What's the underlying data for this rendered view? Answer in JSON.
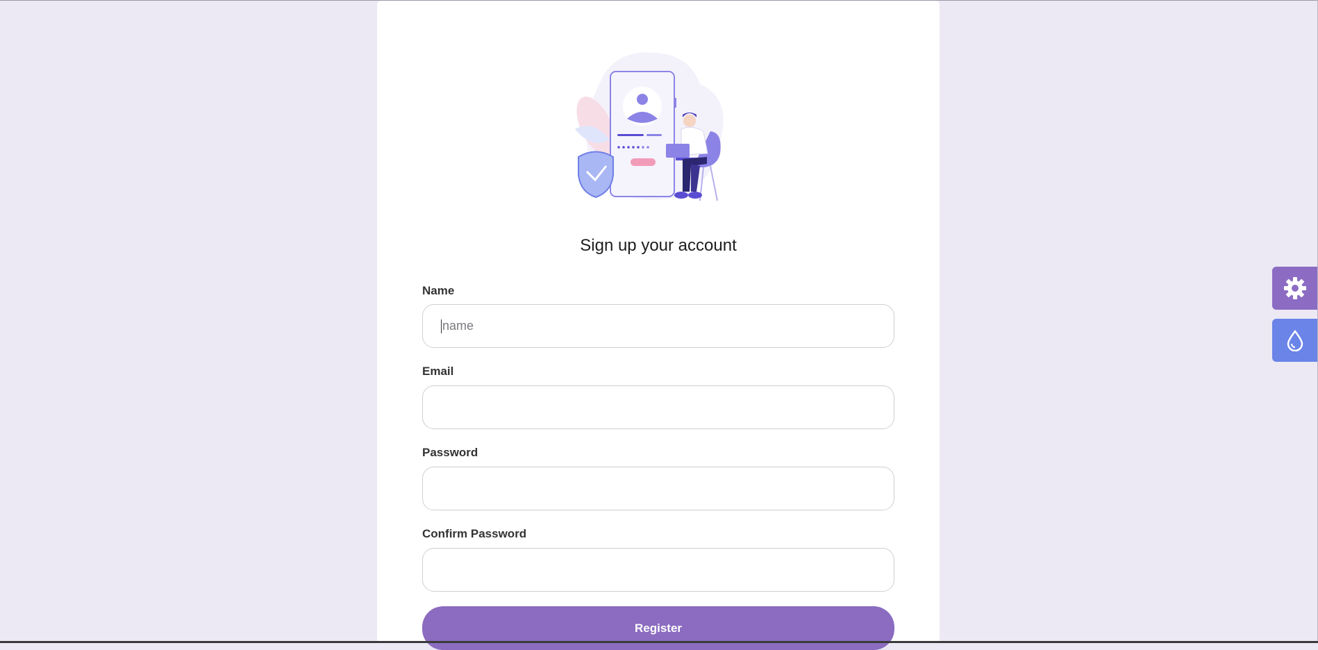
{
  "form": {
    "heading": "Sign up your account",
    "fields": [
      {
        "label": "Name",
        "placeholder": "name",
        "value": ""
      },
      {
        "label": "Email",
        "placeholder": "",
        "value": ""
      },
      {
        "label": "Password",
        "placeholder": "",
        "value": ""
      },
      {
        "label": "Confirm Password",
        "placeholder": "",
        "value": ""
      }
    ],
    "submit_label": "Register"
  },
  "floating_buttons": [
    {
      "icon": "gear-icon",
      "color": "#8c6cc3"
    },
    {
      "icon": "drop-icon",
      "color": "#6a84e8"
    }
  ],
  "colors": {
    "page_background": "#ece9f4",
    "accent": "#8b6cc0"
  }
}
